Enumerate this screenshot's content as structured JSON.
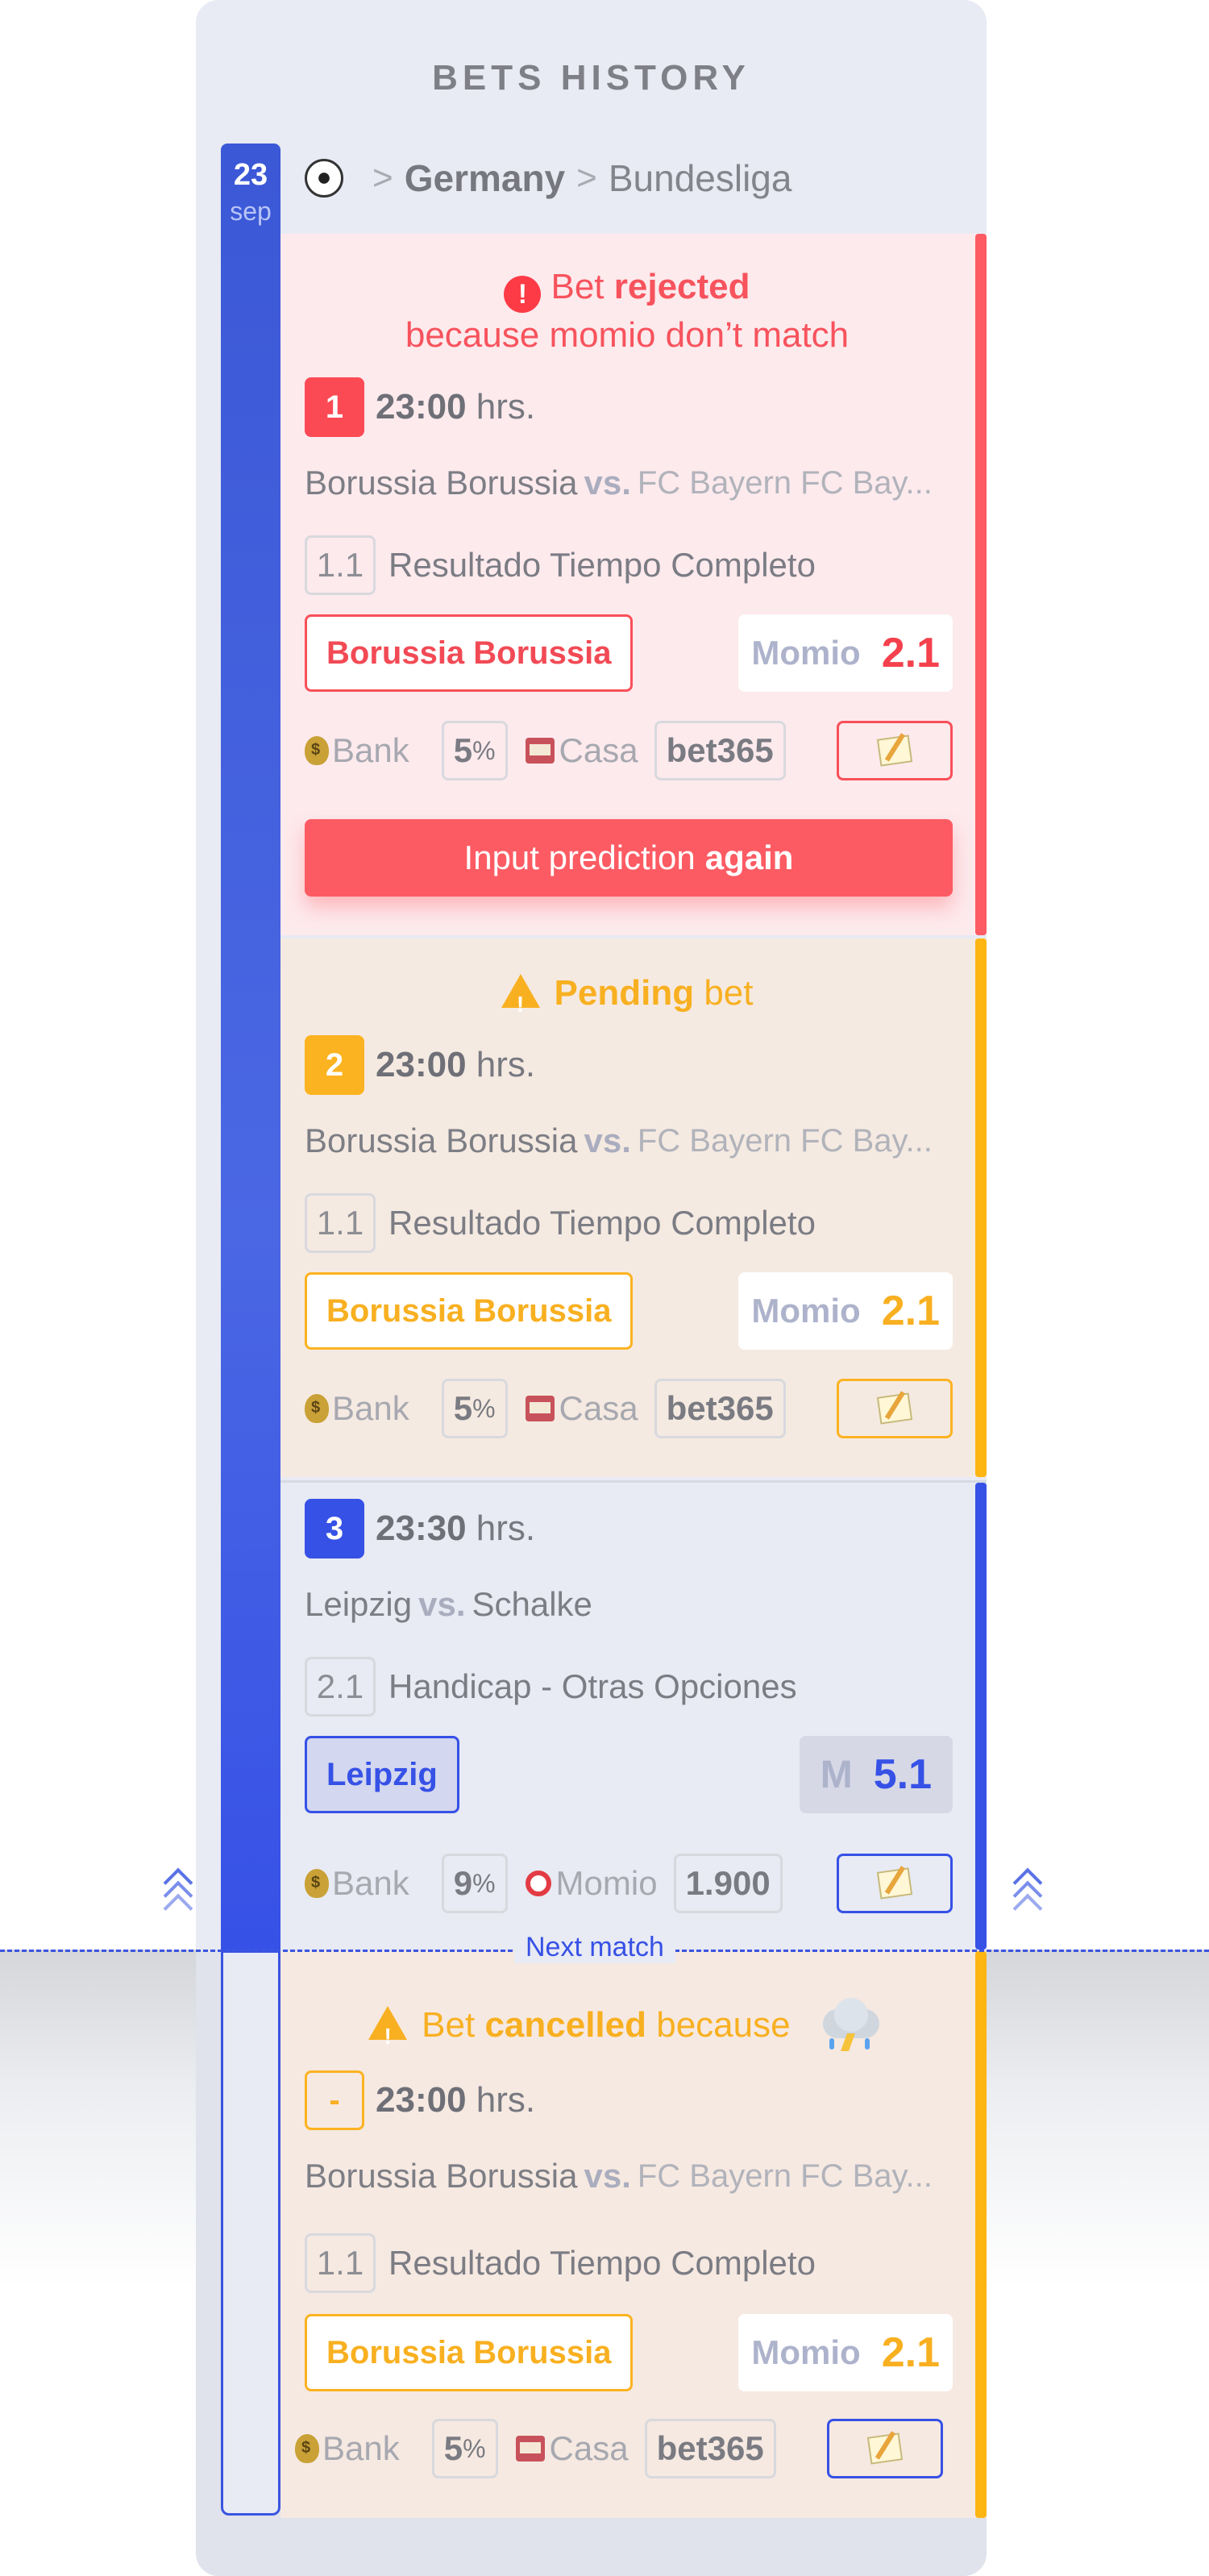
{
  "header": {
    "title": "BETS HISTORY"
  },
  "date": {
    "day": "23",
    "month": "sep"
  },
  "breadcrumb": {
    "country": "Germany",
    "league": "Bundesliga",
    "sport_icon": "soccer-ball-icon"
  },
  "bets": [
    {
      "status_prefix": "Bet",
      "status_strong": "rejected",
      "status_reason": "because momio don’t match",
      "number": "1",
      "time": "23:00",
      "time_unit": "hrs.",
      "home": "Borussia Borussia",
      "vs": "vs.",
      "away": "FC Bayern FC Bay...",
      "market_code": "1.1",
      "market": "Resultado Tiempo Completo",
      "pick": "Borussia Borussia",
      "odds_label": "Momio",
      "odds": "2.1",
      "bank_label": "Bank",
      "bank_value": "5",
      "bank_unit": "%",
      "house_label": "Casa",
      "house": "bet365",
      "action_text": "Input prediction",
      "action_strong": "again",
      "color": "#fc5b63"
    },
    {
      "status_strong": "Pending",
      "status_suffix": "bet",
      "number": "2",
      "time": "23:00",
      "time_unit": "hrs.",
      "home": "Borussia Borussia",
      "vs": "vs.",
      "away": "FC Bayern FC Bay...",
      "market_code": "1.1",
      "market": "Resultado Tiempo Completo",
      "pick": "Borussia Borussia",
      "odds_label": "Momio",
      "odds": "2.1",
      "bank_label": "Bank",
      "bank_value": "5",
      "bank_unit": "%",
      "house_label": "Casa",
      "house": "bet365",
      "color": "#fdb514"
    },
    {
      "number": "3",
      "time": "23:30",
      "time_unit": "hrs.",
      "home": "Leipzig",
      "vs": "vs.",
      "away": "Schalke",
      "market_code": "2.1",
      "market": "Handicap - Otras Opciones",
      "pick": "Leipzig",
      "odds_label": "M",
      "odds": "5.1",
      "bank_label": "Bank",
      "bank_value": "9",
      "bank_unit": "%",
      "house_label": "Momio",
      "house": "1.900",
      "color": "#3651e6"
    },
    {
      "status_prefix": "Bet",
      "status_strong": "cancelled",
      "status_suffix": "because",
      "status_icon": "thunderstorm-cloud-icon",
      "number": "-",
      "time": "23:00",
      "time_unit": "hrs.",
      "home": "Borussia Borussia",
      "vs": "vs.",
      "away": "FC Bayern FC Bay...",
      "market_code": "1.1",
      "market": "Resultado Tiempo Completo",
      "pick": "Borussia Borussia",
      "odds_label": "Momio",
      "odds": "2.1",
      "bank_label": "Bank",
      "bank_value": "5",
      "bank_unit": "%",
      "house_label": "Casa",
      "house": "bet365",
      "color": "#fdb514"
    }
  ],
  "divider": {
    "label": "Next match"
  }
}
